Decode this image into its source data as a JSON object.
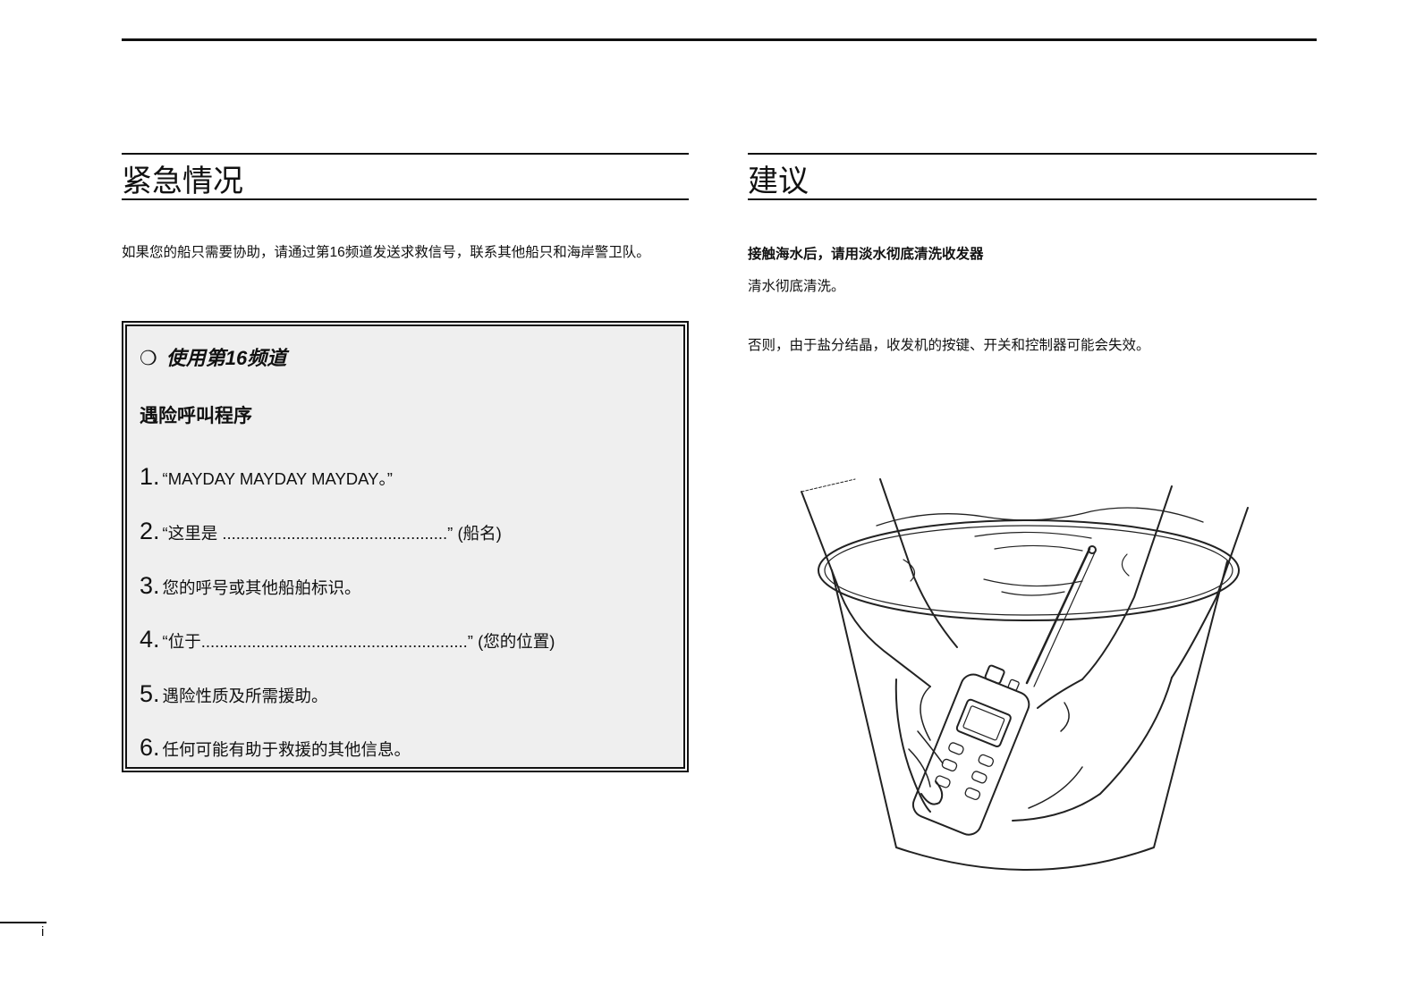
{
  "emergency": {
    "title": "紧急情况",
    "intro": "如果您的船只需要协助，请通过第16频道发送求救信号，联系其他船只和海岸警卫队。",
    "box": {
      "bullet": "❍",
      "heading": "使用第16频道",
      "subheading": "遇险呼叫程序",
      "steps": [
        {
          "num": "1.",
          "text": "“MAYDAY MAYDAY MAYDAY。”"
        },
        {
          "num": "2.",
          "text": "“这里是 .................................................” (船名)"
        },
        {
          "num": "3.",
          "text": "您的呼号或其他船舶标识。"
        },
        {
          "num": "4.",
          "text": "“位于..........................................................” (您的位置)"
        },
        {
          "num": "5.",
          "text": "遇险性质及所需援助。"
        },
        {
          "num": "6.",
          "text": "任何可能有助于救援的其他信息。"
        }
      ]
    }
  },
  "advice": {
    "title": "建议",
    "heading": "接触海水后，请用淡水彻底清洗收发器",
    "line1": "清水彻底清洗。",
    "line2": "否则，由于盐分结晶，收发机的按键、开关和控制器可能会失效。",
    "illustration": "hands-washing-radio-in-bucket"
  },
  "footer": {
    "page_number": "i"
  }
}
